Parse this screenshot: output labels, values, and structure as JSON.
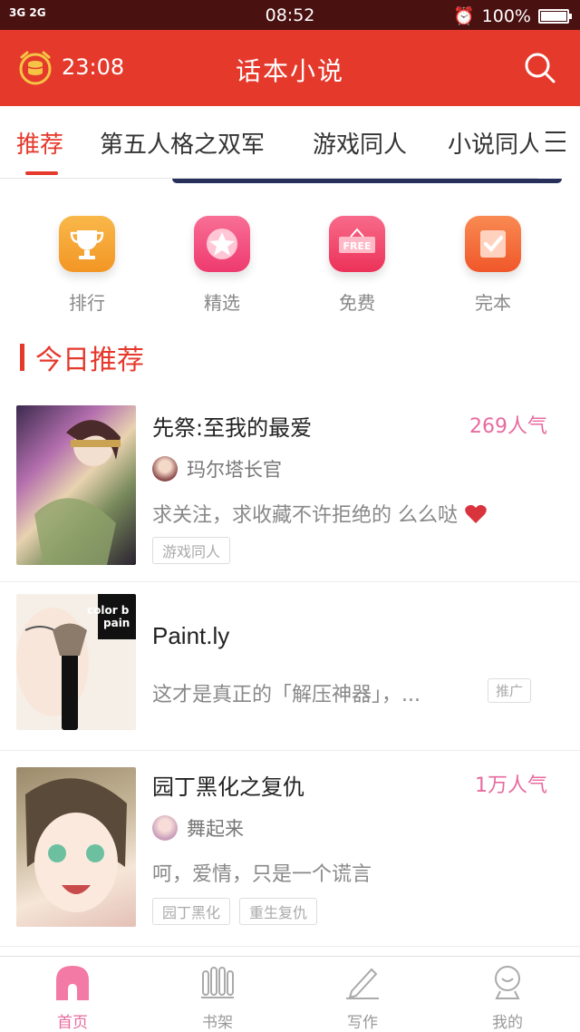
{
  "statusbar": {
    "signal": "3G 2G",
    "time": "08:52",
    "battery": "100%"
  },
  "header": {
    "timer": "23:08",
    "title": "话本小说",
    "icons": [
      "alarm-coin-icon",
      "search-icon"
    ]
  },
  "tabs": [
    {
      "label": "推荐",
      "active": true
    },
    {
      "label": "第五人格之双军",
      "active": false
    },
    {
      "label": "游戏同人",
      "active": false
    },
    {
      "label": "小说同人",
      "active": false
    }
  ],
  "quick_links": [
    {
      "label": "排行",
      "icon": "trophy-icon",
      "color": "#f5a623"
    },
    {
      "label": "精选",
      "icon": "star-icon",
      "color": "#f24f80"
    },
    {
      "label": "免费",
      "icon": "free-icon",
      "color": "#f0436b"
    },
    {
      "label": "完本",
      "icon": "check-icon",
      "color": "#f56b33"
    }
  ],
  "section": {
    "title": "今日推荐"
  },
  "books": [
    {
      "title": "先祭:至我的最爱",
      "popularity": "269人气",
      "author": "玛尔塔长官",
      "desc": "求关注，求收藏不许拒绝的 么么哒",
      "tags": [
        "游戏同人"
      ]
    },
    {
      "title": "Paint.ly",
      "desc": "这才是真正的「解压神器」，...",
      "ad_label": "推广",
      "cover_text": "color b\npain"
    },
    {
      "title": "园丁黑化之复仇",
      "popularity": "1万人气",
      "author": "舞起来",
      "desc": "呵，爱情，只是一个谎言",
      "tags": [
        "园丁黑化",
        "重生复仇"
      ]
    }
  ],
  "bottom_nav": [
    {
      "label": "首页",
      "icon": "home-icon",
      "active": true
    },
    {
      "label": "书架",
      "icon": "bookshelf-icon",
      "active": false
    },
    {
      "label": "写作",
      "icon": "pen-icon",
      "active": false
    },
    {
      "label": "我的",
      "icon": "profile-icon",
      "active": false
    }
  ],
  "colors": {
    "accent": "#e5392c",
    "pink": "#e86a9f"
  }
}
